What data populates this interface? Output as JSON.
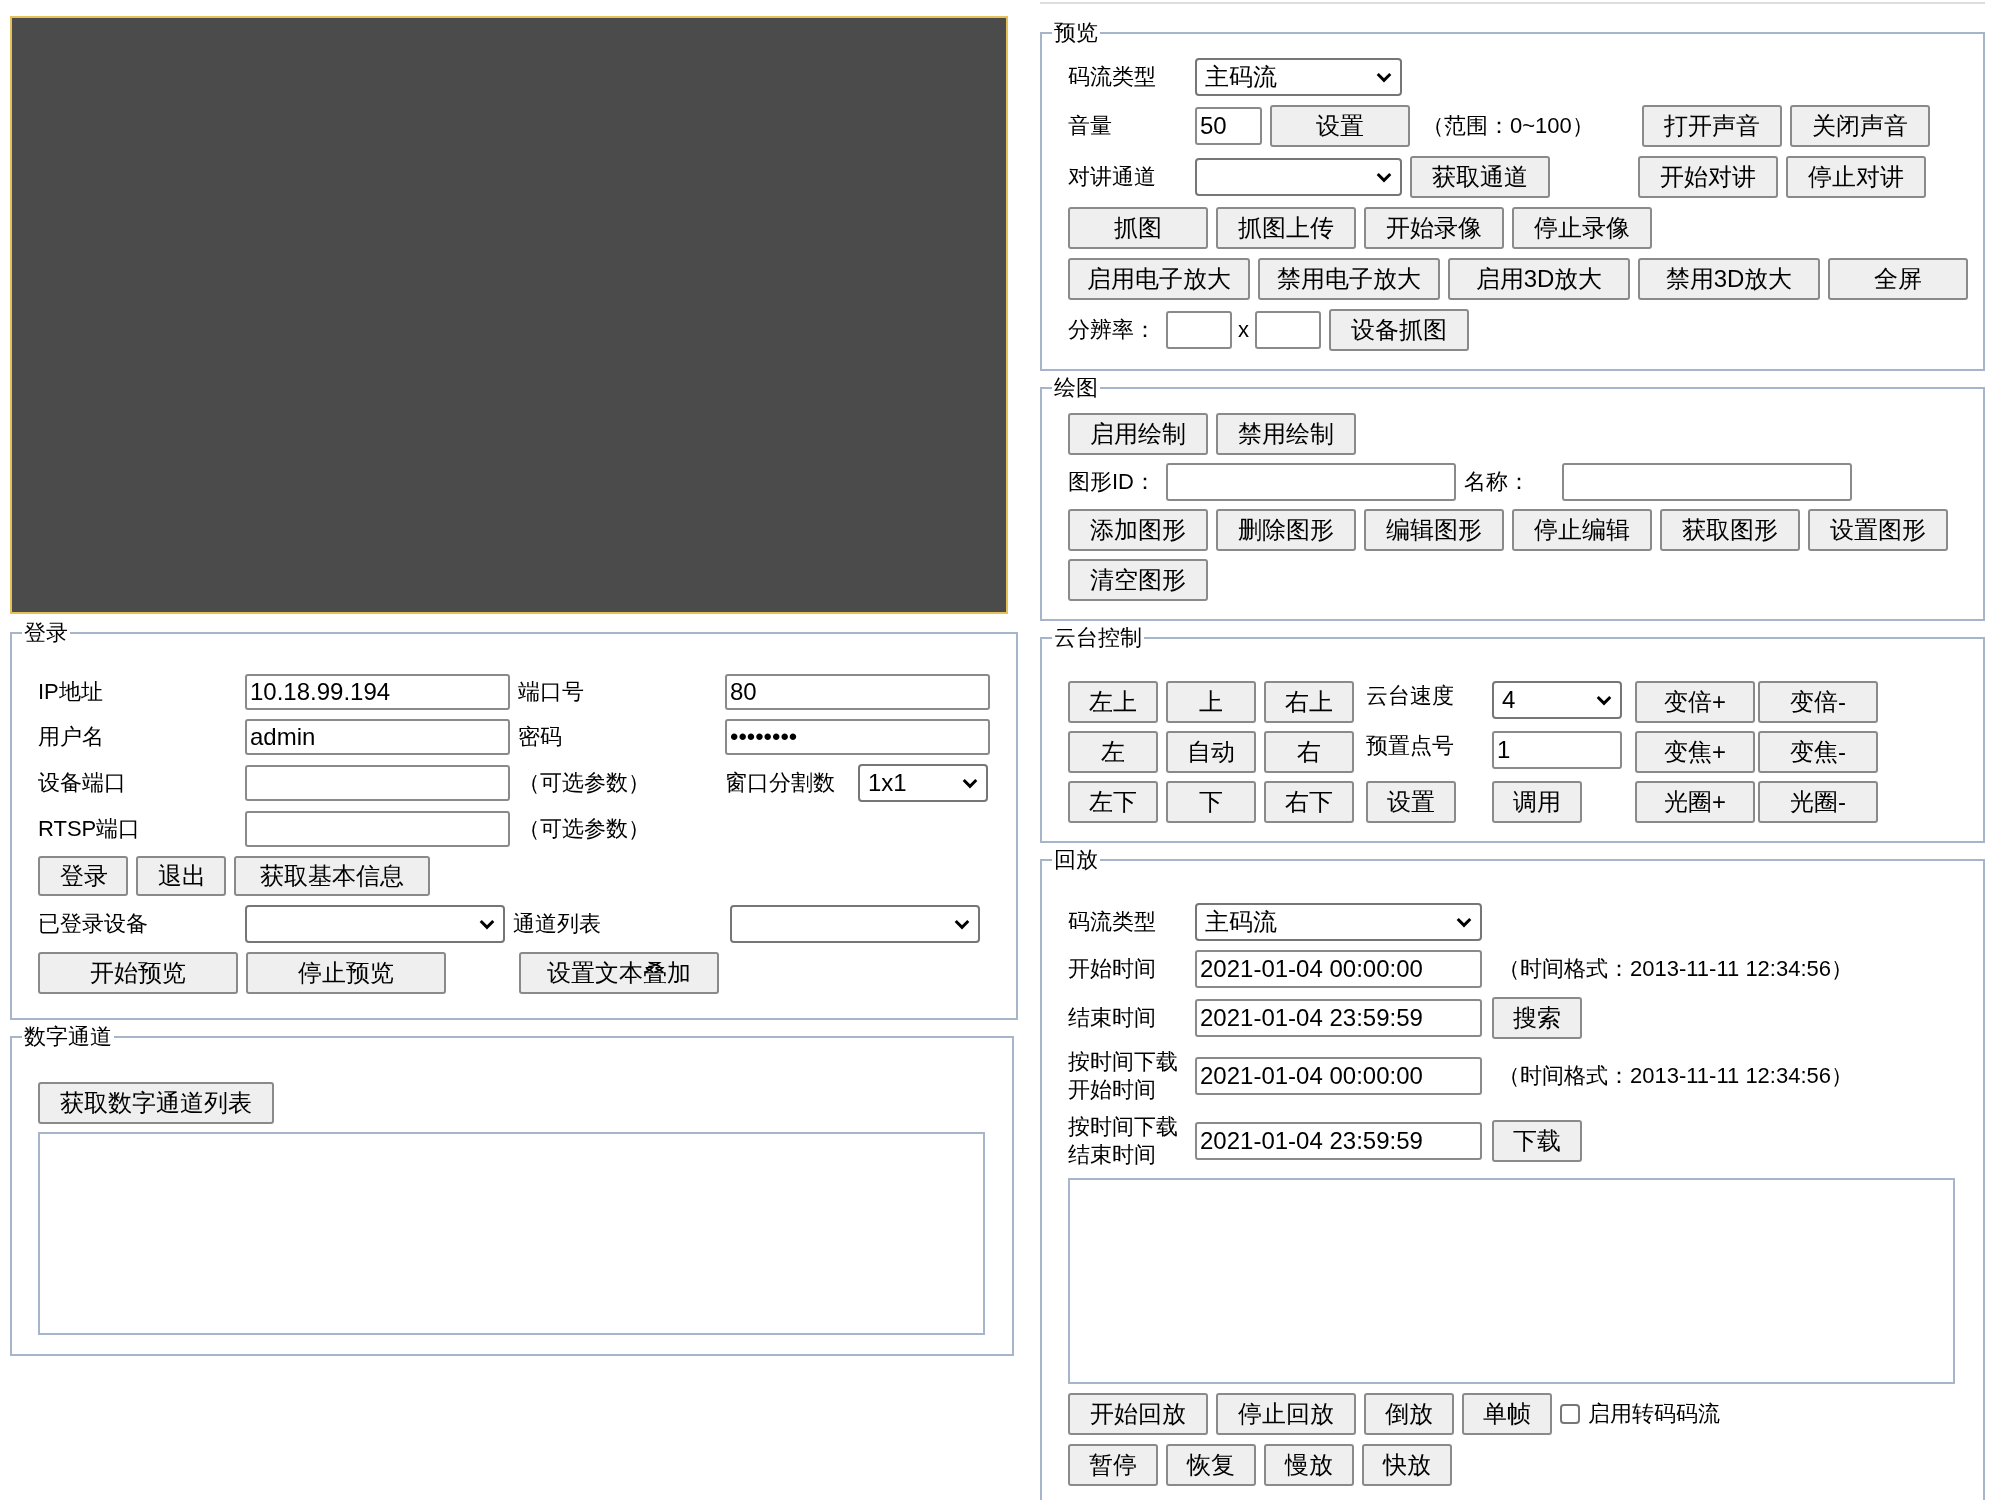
{
  "login": {
    "legend": "登录",
    "rows": [
      {
        "items": [
          {
            "kind": "label",
            "text": "IP地址"
          },
          {
            "kind": "input",
            "value": "10.18.99.194"
          },
          {
            "kind": "label",
            "text": "端口号"
          },
          {
            "kind": "input",
            "value": "80"
          }
        ]
      },
      {
        "items": [
          {
            "kind": "label",
            "text": "用户名"
          },
          {
            "kind": "input",
            "value": "admin"
          },
          {
            "kind": "label",
            "text": "密码"
          },
          {
            "kind": "input",
            "value": "••••••••"
          }
        ]
      },
      {
        "items": [
          {
            "kind": "label",
            "text": "设备端口"
          },
          {
            "kind": "input"
          },
          {
            "kind": "note",
            "text": "（可选参数）"
          },
          {
            "kind": "label",
            "text": "窗口分割数"
          },
          {
            "kind": "select",
            "value": "1x1"
          }
        ]
      },
      {
        "items": [
          {
            "kind": "label",
            "text": "RTSP端口"
          },
          {
            "kind": "input"
          },
          {
            "kind": "note",
            "text": "（可选参数）"
          }
        ]
      },
      {
        "items": [
          {
            "kind": "button",
            "text": "登录"
          },
          {
            "kind": "button",
            "text": "退出"
          },
          {
            "kind": "button",
            "text": "获取基本信息"
          }
        ]
      },
      {
        "items": [
          {
            "kind": "label",
            "text": "已登录设备"
          },
          {
            "kind": "select"
          },
          {
            "kind": "label",
            "text": "通道列表"
          },
          {
            "kind": "select"
          }
        ]
      },
      {
        "items": [
          {
            "kind": "button",
            "text": "开始预览"
          },
          {
            "kind": "button",
            "text": "停止预览"
          },
          {
            "kind": "button",
            "text": "设置文本叠加"
          }
        ]
      }
    ]
  },
  "digital_channels": {
    "legend": "数字通道",
    "rows": [
      {
        "items": [
          {
            "kind": "button",
            "text": "获取数字通道列表"
          }
        ]
      },
      {
        "items": [
          {
            "kind": "box"
          }
        ]
      }
    ]
  },
  "preview": {
    "legend": "预览",
    "rows": [
      {
        "items": [
          {
            "kind": "label",
            "text": "码流类型"
          },
          {
            "kind": "select",
            "value": "主码流"
          }
        ]
      },
      {
        "items": [
          {
            "kind": "label",
            "text": "音量"
          },
          {
            "kind": "input",
            "value": "50"
          },
          {
            "kind": "button",
            "text": "设置"
          },
          {
            "kind": "note",
            "text": "（范围：0~100）"
          },
          {
            "kind": "button",
            "text": "打开声音"
          },
          {
            "kind": "button",
            "text": "关闭声音"
          }
        ]
      },
      {
        "items": [
          {
            "kind": "label",
            "text": "对讲通道"
          },
          {
            "kind": "select"
          },
          {
            "kind": "button",
            "text": "获取通道"
          },
          {
            "kind": "button",
            "text": "开始对讲"
          },
          {
            "kind": "button",
            "text": "停止对讲"
          }
        ]
      },
      {
        "items": [
          {
            "kind": "button",
            "text": "抓图"
          },
          {
            "kind": "button",
            "text": "抓图上传"
          },
          {
            "kind": "button",
            "text": "开始录像"
          },
          {
            "kind": "button",
            "text": "停止录像"
          }
        ]
      },
      {
        "items": [
          {
            "kind": "button",
            "text": "启用电子放大"
          },
          {
            "kind": "button",
            "text": "禁用电子放大"
          },
          {
            "kind": "button",
            "text": "启用3D放大"
          },
          {
            "kind": "button",
            "text": "禁用3D放大"
          },
          {
            "kind": "button",
            "text": "全屏"
          }
        ]
      },
      {
        "items": [
          {
            "kind": "label",
            "text": "分辨率："
          },
          {
            "kind": "input"
          },
          {
            "kind": "text",
            "text": "x"
          },
          {
            "kind": "input"
          },
          {
            "kind": "button",
            "text": "设备抓图"
          }
        ]
      }
    ]
  },
  "drawing": {
    "legend": "绘图",
    "rows": [
      {
        "items": [
          {
            "kind": "button",
            "text": "启用绘制"
          },
          {
            "kind": "button",
            "text": "禁用绘制"
          }
        ]
      },
      {
        "items": [
          {
            "kind": "label",
            "text": "图形ID："
          },
          {
            "kind": "input"
          },
          {
            "kind": "label",
            "text": "名称："
          },
          {
            "kind": "input"
          }
        ]
      },
      {
        "items": [
          {
            "kind": "button",
            "text": "添加图形"
          },
          {
            "kind": "button",
            "text": "删除图形"
          },
          {
            "kind": "button",
            "text": "编辑图形"
          },
          {
            "kind": "button",
            "text": "停止编辑"
          },
          {
            "kind": "button",
            "text": "获取图形"
          },
          {
            "kind": "button",
            "text": "设置图形"
          }
        ]
      },
      {
        "items": [
          {
            "kind": "button",
            "text": "清空图形"
          }
        ]
      }
    ]
  },
  "ptz": {
    "legend": "云台控制",
    "rows": [
      {
        "items": [
          {
            "kind": "button",
            "text": "左上"
          },
          {
            "kind": "button",
            "text": "上"
          },
          {
            "kind": "button",
            "text": "右上"
          },
          {
            "kind": "label",
            "text": "云台速度"
          },
          {
            "kind": "select",
            "value": "4"
          },
          {
            "kind": "button",
            "text": "变倍+"
          },
          {
            "kind": "button",
            "text": "变倍-"
          }
        ]
      },
      {
        "items": [
          {
            "kind": "button",
            "text": "左"
          },
          {
            "kind": "button",
            "text": "自动"
          },
          {
            "kind": "button",
            "text": "右"
          },
          {
            "kind": "label",
            "text": "预置点号"
          },
          {
            "kind": "input",
            "value": "1"
          },
          {
            "kind": "button",
            "text": "变焦+"
          },
          {
            "kind": "button",
            "text": "变焦-"
          }
        ]
      },
      {
        "items": [
          {
            "kind": "button",
            "text": "左下"
          },
          {
            "kind": "button",
            "text": "下"
          },
          {
            "kind": "button",
            "text": "右下"
          },
          {
            "kind": "button",
            "text": "设置"
          },
          {
            "kind": "button",
            "text": "调用"
          },
          {
            "kind": "button",
            "text": "光圈+"
          },
          {
            "kind": "button",
            "text": "光圈-"
          }
        ]
      }
    ]
  },
  "playback": {
    "legend": "回放",
    "rows": [
      {
        "items": [
          {
            "kind": "label",
            "text": "码流类型"
          },
          {
            "kind": "select",
            "value": "主码流"
          }
        ]
      },
      {
        "items": [
          {
            "kind": "label",
            "text": "开始时间"
          },
          {
            "kind": "input",
            "value": "2021-01-04 00:00:00"
          },
          {
            "kind": "note",
            "text": "（时间格式：2013-11-11 12:34:56）"
          }
        ]
      },
      {
        "items": [
          {
            "kind": "label",
            "text": "结束时间"
          },
          {
            "kind": "input",
            "value": "2021-01-04 23:59:59"
          },
          {
            "kind": "button",
            "text": "搜索"
          }
        ]
      },
      {
        "items": [
          {
            "kind": "label",
            "text": "按时间下载开始时间"
          },
          {
            "kind": "input",
            "value": "2021-01-04 00:00:00"
          },
          {
            "kind": "note",
            "text": "（时间格式：2013-11-11 12:34:56）"
          }
        ]
      },
      {
        "items": [
          {
            "kind": "label",
            "text": "按时间下载结束时间"
          },
          {
            "kind": "input",
            "value": "2021-01-04 23:59:59"
          },
          {
            "kind": "button",
            "text": "下载"
          }
        ]
      },
      {
        "items": [
          {
            "kind": "box"
          }
        ]
      },
      {
        "items": [
          {
            "kind": "button",
            "text": "开始回放"
          },
          {
            "kind": "button",
            "text": "停止回放"
          },
          {
            "kind": "button",
            "text": "倒放"
          },
          {
            "kind": "button",
            "text": "单帧"
          },
          {
            "kind": "checkbox",
            "text": "启用转码码流",
            "checked": false
          }
        ]
      },
      {
        "items": [
          {
            "kind": "button",
            "text": "暂停"
          },
          {
            "kind": "button",
            "text": "恢复"
          },
          {
            "kind": "button",
            "text": "慢放"
          },
          {
            "kind": "button",
            "text": "快放"
          }
        ]
      }
    ]
  }
}
